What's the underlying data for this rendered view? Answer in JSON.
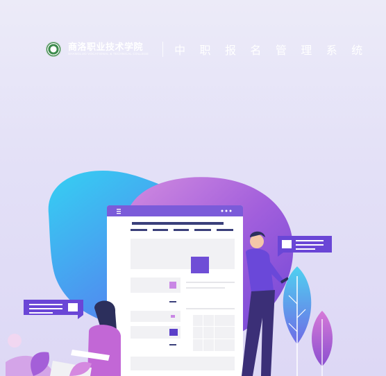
{
  "header": {
    "school_name": "商洛职业技术学院",
    "school_english": "SHANGLUO VOCATIONAL & TECHNICAL COLLEGE",
    "system_title": "中 职 报 名 管 理 系 统"
  },
  "colors": {
    "background_top": "#ecebf8",
    "background_bottom": "#ddd8f5",
    "accent_purple": "#6c47d9",
    "accent_pink": "#b46bd6",
    "accent_cyan": "#3cc6ef"
  },
  "icons": [
    "school-logo-icon",
    "menu-icon",
    "more-dots-icon"
  ]
}
